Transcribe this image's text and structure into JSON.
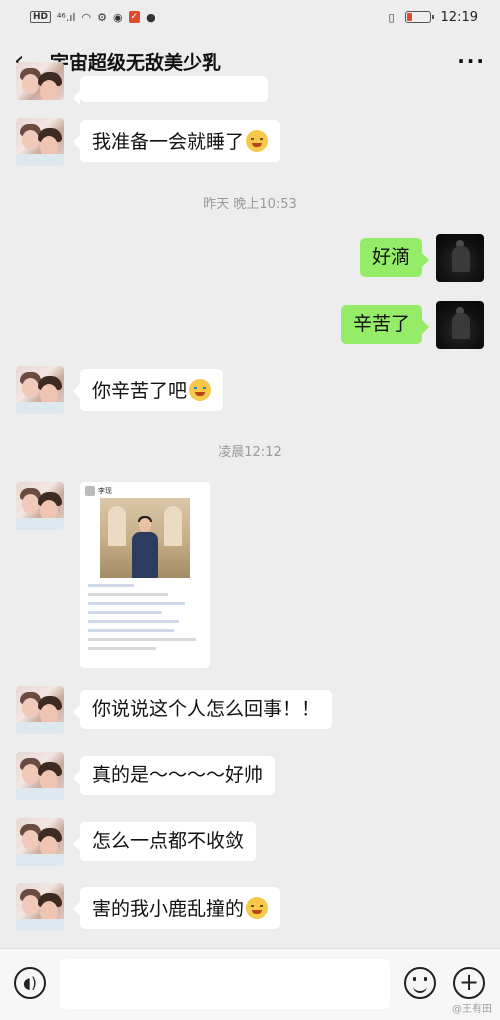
{
  "status_bar": {
    "time": "12:19",
    "left_glyphs": "HD ⁴⁶ .ıl",
    "battery_level": 0.2
  },
  "header": {
    "back_label": "<",
    "title": "宇宙超级无敌美少乳",
    "more_label": "···"
  },
  "messages": [
    {
      "from": "them",
      "text": "我准备一会就睡了",
      "emoji": "tears-of-joy-emoji"
    },
    {
      "type": "timestamp",
      "text": "昨天 晚上10:53"
    },
    {
      "from": "me",
      "text": "好滴"
    },
    {
      "from": "me",
      "text": "辛苦了"
    },
    {
      "from": "them",
      "text": "你辛苦了吧",
      "emoji": "crying-emoji"
    },
    {
      "type": "timestamp",
      "text": "凌晨12:12"
    },
    {
      "from": "them",
      "type": "image",
      "caption": "screenshot-card"
    },
    {
      "from": "them",
      "text": "你说说这个人怎么回事！！"
    },
    {
      "from": "them",
      "text": "真的是～～～～好帅"
    },
    {
      "from": "them",
      "text": "怎么一点都不收敛"
    },
    {
      "from": "them",
      "text": "害的我小鹿乱撞的",
      "emoji": "blush-emoji"
    }
  ],
  "card": {
    "author": "李现"
  },
  "bottom_bar": {
    "voice_icon": "voice-icon",
    "emoji_icon": "emoji-icon",
    "plus_icon": "plus-icon"
  },
  "watermark": "@王有田"
}
